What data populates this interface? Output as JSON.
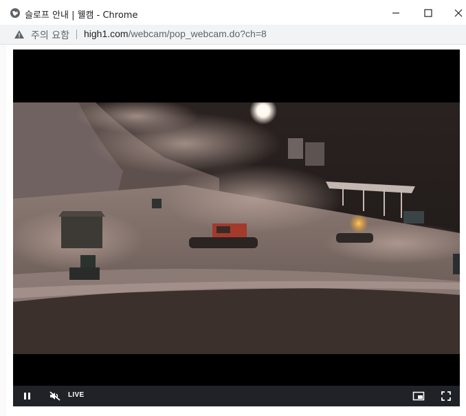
{
  "window": {
    "title": "슬로프 안내 | 웰캠 - Chrome"
  },
  "addressbar": {
    "security_text": "주의 요함",
    "url_host": "high1.com",
    "url_path": "/webcam/pop_webcam.do?ch=8"
  },
  "player": {
    "live_label": "LIVE",
    "scene": "Night ski slope with snowmaking guns and snow groomers"
  },
  "icons": {
    "site": "globe-icon",
    "warning": "warning-icon",
    "pause": "pause-icon",
    "mute": "muted-speaker-icon",
    "pip": "picture-in-picture-icon",
    "fullscreen": "fullscreen-icon"
  },
  "colors": {
    "controls_bg": "#1f2328",
    "video_sky": "#1a1616",
    "snow": "#8e7b76"
  }
}
